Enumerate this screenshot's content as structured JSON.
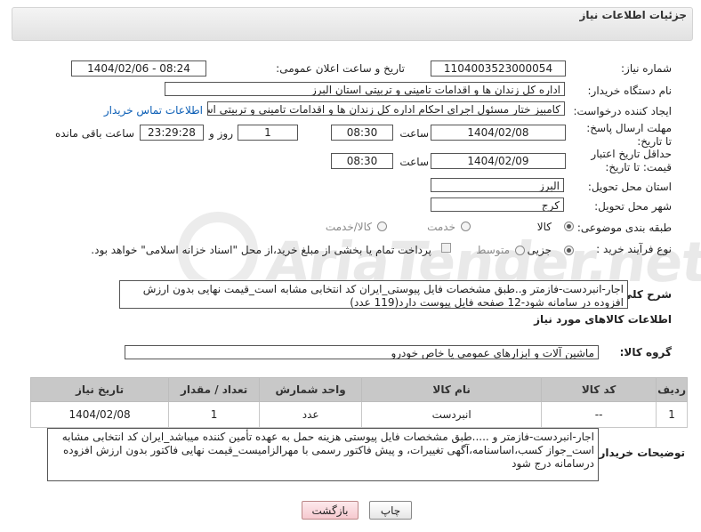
{
  "header": {
    "title": "جزئیات اطلاعات نیاز"
  },
  "watermark": {
    "text": "AriaTender.net"
  },
  "fields": {
    "need_number_label": "شماره نیاز:",
    "need_number": "1104003523000054",
    "announce_label": "تاریخ و ساعت اعلان عمومی:",
    "announce_value": "1404/02/06 - 08:24",
    "buyer_org_label": "نام دستگاه خریدار:",
    "buyer_org": "اداره کل زندان ها و اقدامات تامینی و تربیتی استان البرز",
    "requester_label": "ایجاد کننده درخواست:",
    "requester": "کامبیز ختار مسئول اجرای احکام اداره کل زندان ها و اقدامات تامینی و تربیتی استان البرز",
    "contact_link": "اطلاعات تماس خریدار",
    "send_deadline_label": "مهلت ارسال پاسخ: تا تاریخ:",
    "send_date": "1404/02/08",
    "time_label": "ساعت",
    "send_time": "08:30",
    "days_value": "1",
    "days_label": "روز و",
    "remaining_value": "23:29:28",
    "remaining_label": "ساعت باقی مانده",
    "price_deadline_label": "حداقل تاریخ اعتبار قیمت: تا تاریخ:",
    "price_date": "1404/02/09",
    "price_time": "08:30",
    "delivery_province_label": "استان محل تحویل:",
    "delivery_province": "البرز",
    "delivery_city_label": "شهر محل تحویل:",
    "delivery_city": "کرج",
    "category_label": "طبقه بندی موضوعی:",
    "category_options": [
      "کالا",
      "خدمت",
      "کالا/خدمت"
    ],
    "process_label": "نوع فرآیند خرید :",
    "process_options": [
      "جزیی",
      "متوسط"
    ],
    "payment_note": "پرداخت تمام یا بخشی از مبلغ خرید،از محل \"اسناد خزانه اسلامی\" خواهد بود."
  },
  "description": {
    "label": "شرح کلی نیاز:",
    "text": "اجار-انبردست-فازمتر  و..طبق مشخصات فایل پیوستی_ایران کد انتخابی مشابه است_قیمت نهایی بدون ارزش افزوده در سامانه  شود-12 صفحه فایل پیوست دارد(119 عدد)"
  },
  "goods_section": {
    "title": "اطلاعات کالاهای مورد نیاز",
    "group_label": "گروه کالا:",
    "group_value": "ماشین آلات و ابزارهای عمومی یا خاص خودرو"
  },
  "table": {
    "headers": [
      "ردیف",
      "کد کالا",
      "نام کالا",
      "واحد شمارش",
      "تعداد / مقدار",
      "تاریخ نیاز"
    ],
    "rows": [
      [
        "1",
        "--",
        "انبردست",
        "عدد",
        "1",
        "1404/02/08"
      ]
    ]
  },
  "buyer_notes": {
    "label": "توضیحات خریدار:",
    "text": "اجار-انبردست-فازمتر و .....طبق مشخصات فایل پیوستی هزینه حمل به عهده تأمین کننده میباشد_ایران کد انتخابی مشابه است_جواز کسب،اساسنامه،آگهی تغییرات، و پیش فاکتور رسمی با مهرالزامیست_قیمت نهایی فاکتور بدون ارزش افزوده درسامانه درج شود"
  },
  "buttons": {
    "print": "چاپ",
    "back": "بازگشت"
  }
}
